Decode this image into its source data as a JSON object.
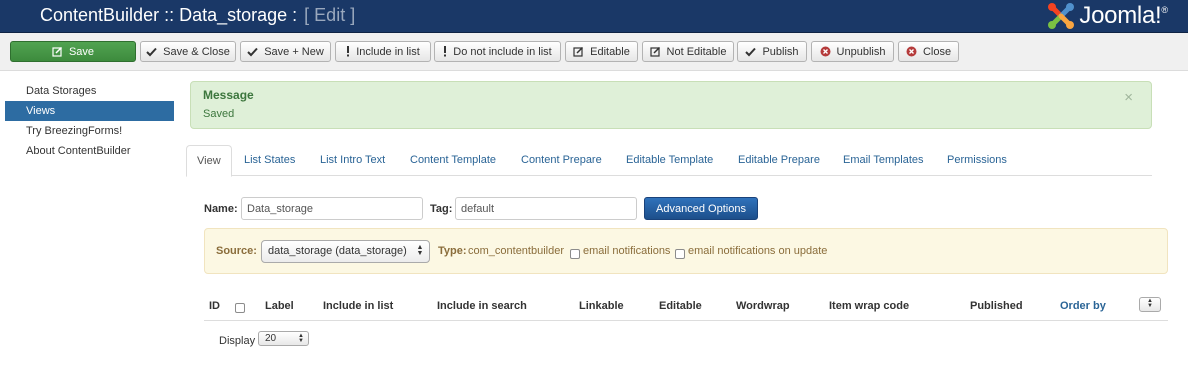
{
  "header": {
    "title": "ContentBuilder :: Data_storage :",
    "edit_label": "[ Edit ]",
    "logo_text": "Joomla!",
    "logo_reg": "®"
  },
  "toolbar": {
    "save": "Save",
    "save_close": "Save & Close",
    "save_new": "Save + New",
    "include": "Include in list",
    "not_include": "Do not include in list",
    "editable": "Editable",
    "not_editable": "Not Editable",
    "publish": "Publish",
    "unpublish": "Unpublish",
    "close": "Close"
  },
  "sidebar": {
    "items": [
      {
        "label": "Data Storages"
      },
      {
        "label": "Views"
      },
      {
        "label": "Try BreezingForms!"
      },
      {
        "label": "About ContentBuilder"
      }
    ]
  },
  "alert": {
    "heading": "Message",
    "text": "Saved",
    "close": "×"
  },
  "tabs": [
    {
      "label": "View"
    },
    {
      "label": "List States"
    },
    {
      "label": "List Intro Text"
    },
    {
      "label": "Content Template"
    },
    {
      "label": "Content Prepare"
    },
    {
      "label": "Editable Template"
    },
    {
      "label": "Editable Prepare"
    },
    {
      "label": "Email Templates"
    },
    {
      "label": "Permissions"
    }
  ],
  "form": {
    "name_label": "Name:",
    "name_value": "Data_storage",
    "tag_label": "Tag:",
    "tag_value": "default",
    "advanced_button": "Advanced Options"
  },
  "source": {
    "label": "Source:",
    "value": "data_storage (data_storage)",
    "type_label": "Type:",
    "type_value": "com_contentbuilder",
    "email_notifications": "email notifications",
    "email_notifications_update": "email notifications on update"
  },
  "table": {
    "columns": {
      "id": "ID",
      "label": "Label",
      "include_list": "Include in list",
      "include_search": "Include in search",
      "linkable": "Linkable",
      "editable": "Editable",
      "wordwrap": "Wordwrap",
      "item_wrap": "Item wrap code",
      "published": "Published",
      "order_by": "Order by"
    }
  },
  "display": {
    "label": "Display",
    "value": "20"
  },
  "colors": {
    "header_bg": "#1a3867",
    "save_green": "#46a046",
    "sidebar_active": "#2d6ca2",
    "link_blue": "#2a6496",
    "primary_blue": "#24599e",
    "alert_bg": "#dff0d8",
    "source_bg": "#fcf8e3"
  },
  "icons": {
    "save": "edit-icon",
    "save_close": "check-icon",
    "save_new": "check-icon",
    "include": "exclamation-icon",
    "not_include": "exclamation-icon",
    "editable": "edit-icon",
    "not_editable": "edit-icon",
    "publish": "check-icon",
    "unpublish": "cancel-circle-icon",
    "close": "cancel-circle-icon"
  }
}
